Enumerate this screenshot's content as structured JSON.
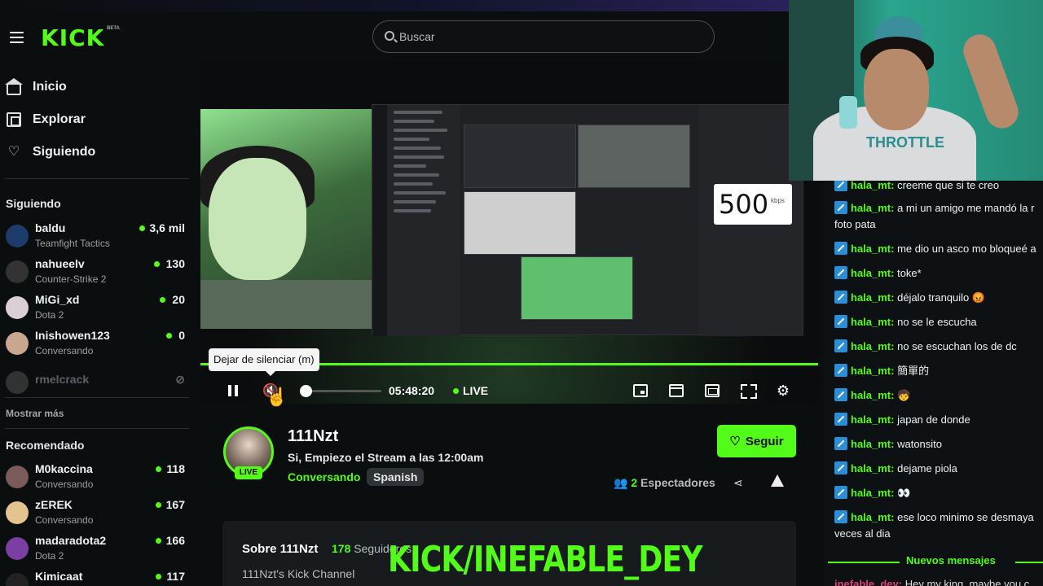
{
  "header": {
    "logo": "KICK",
    "logo_badge": "BETA",
    "search_placeholder": "Buscar"
  },
  "sidebar": {
    "nav": [
      {
        "label": "Inicio",
        "icon": "home-icon"
      },
      {
        "label": "Explorar",
        "icon": "explore-icon"
      },
      {
        "label": "Siguiendo",
        "icon": "heart-icon"
      }
    ],
    "following_title": "Siguiendo",
    "following": [
      {
        "name": "baldu",
        "category": "Teamfight Tactics",
        "viewers": "3,6 mil"
      },
      {
        "name": "nahueelv",
        "category": "Counter-Strike 2",
        "viewers": "130"
      },
      {
        "name": "MiGi_xd",
        "category": "Dota 2",
        "viewers": "20"
      },
      {
        "name": "Inishowen123",
        "category": "Conversando",
        "viewers": "0"
      },
      {
        "name": "rmelcrack",
        "category": "",
        "viewers": ""
      }
    ],
    "show_more": "Mostrar más",
    "recommended_title": "Recomendado",
    "recommended": [
      {
        "name": "M0kaccina",
        "category": "Conversando",
        "viewers": "118"
      },
      {
        "name": "zEREK",
        "category": "Conversando",
        "viewers": "167"
      },
      {
        "name": "madaradota2",
        "category": "Dota 2",
        "viewers": "166"
      },
      {
        "name": "Kimicaat",
        "category": "",
        "viewers": "117"
      }
    ]
  },
  "player": {
    "tooltip": "Dejar de silenciar (m)",
    "time": "05:48:20",
    "live": "LIVE",
    "speed_value": "500",
    "speed_unit": "kbps",
    "volume": 0
  },
  "channel": {
    "name": "111Nzt",
    "live_badge": "LIVE",
    "title": "Si, Empiezo el Stream a las 12:00am",
    "category": "Conversando",
    "language": "Spanish",
    "follow_label": "Seguir",
    "viewers_count": "2",
    "viewers_label": "Espectadores",
    "about_title": "Sobre 111Nzt",
    "followers_count": "178",
    "followers_label": "Seguidores",
    "about_desc": "111Nzt's Kick Channel"
  },
  "overlay_text": "KICK/INEFABLE_DEY",
  "webcam": {
    "shirt_text": "THROTTLE"
  },
  "chat": {
    "messages": [
      {
        "user": "hala_mt",
        "text": "creeme que si te creo"
      },
      {
        "user": "hala_mt",
        "text": "a mi un amigo me mandó la r foto pata"
      },
      {
        "user": "hala_mt",
        "text": "me dio un asco mo bloqueé a"
      },
      {
        "user": "hala_mt",
        "text": "toke*"
      },
      {
        "user": "hala_mt",
        "text": "déjalo tranquilo 😡"
      },
      {
        "user": "hala_mt",
        "text": "no se le escucha"
      },
      {
        "user": "hala_mt",
        "text": "no se escuchan los de dc"
      },
      {
        "user": "hala_mt",
        "text": "簡單的"
      },
      {
        "user": "hala_mt",
        "text": "🧒"
      },
      {
        "user": "hala_mt",
        "text": "japan de donde"
      },
      {
        "user": "hala_mt",
        "text": "watonsito"
      },
      {
        "user": "hala_mt",
        "text": "dejame piola"
      },
      {
        "user": "hala_mt",
        "text": "👀"
      },
      {
        "user": "hala_mt",
        "text": "ese loco minimo se desmaya veces al dia"
      }
    ],
    "new_messages": "Nuevos mensajes",
    "last_user": "inefable_dey:",
    "last_text": "Hey my king, maybe you c"
  },
  "colors": {
    "accent": "#53fc18",
    "background": "#0b0e0f",
    "chat_badge": "#2a8fd6"
  }
}
